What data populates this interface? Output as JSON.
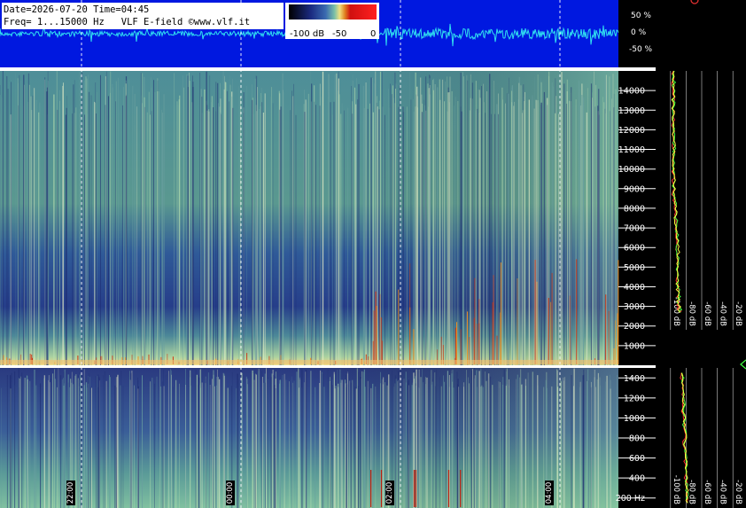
{
  "header": {
    "line1": "Date=2026-07-20 Time=04:45",
    "line2": "Freq= 1...15000 Hz   VLF E-field ©www.vlf.it"
  },
  "colorbar": {
    "labels": [
      "-100 dB",
      "-50",
      "0"
    ],
    "stops": [
      "#000000",
      "#1a2a80",
      "#3a6ab0",
      "#7ac0a8",
      "#f0e080",
      "#e08020",
      "#d01010",
      "#ff2020"
    ]
  },
  "waveform": {
    "ticks": [
      "50 %",
      "0 %",
      "-50 %"
    ],
    "background": "#0018e0",
    "trace_color": "#30e0f0"
  },
  "time_markers": [
    "22:00",
    "00:00",
    "02:00",
    "04:00"
  ],
  "chart_data": [
    {
      "type": "heatmap",
      "name": "upper-spectrogram",
      "y_ticks": [
        "14000",
        "13000",
        "12000",
        "11000",
        "10000",
        "9000",
        "8000",
        "7000",
        "6000",
        "5000",
        "4000",
        "3000",
        "2000",
        "1000"
      ],
      "ylim": [
        0,
        15000
      ],
      "x_ticks": [
        "22:00",
        "00:00",
        "02:00",
        "04:00"
      ],
      "grid": true
    },
    {
      "type": "heatmap",
      "name": "lower-spectrogram",
      "y_ticks": [
        "1400",
        "1200",
        "1000",
        "800",
        "600",
        "400",
        "200 Hz"
      ],
      "ylim": [
        100,
        1500
      ],
      "x_ticks": [
        "22:00",
        "00:00",
        "02:00",
        "04:00"
      ],
      "grid": true
    },
    {
      "type": "line",
      "name": "upper-spectrum",
      "x_ticks": [
        "-100 dB",
        "-80 dB",
        "-60 dB",
        "-40 dB",
        "-20 dB"
      ],
      "xlim": [
        -110,
        -10
      ],
      "series": [
        {
          "color": "#ff3030",
          "x": [
            -96,
            -97,
            -96,
            -97,
            -96,
            -97,
            -96,
            -97,
            -95,
            -93,
            -92,
            -91,
            -92,
            -90,
            -91,
            -88
          ],
          "y": [
            15000,
            14000,
            13000,
            12000,
            11000,
            10000,
            9000,
            8000,
            7000,
            6000,
            5000,
            4000,
            3000,
            2000,
            1500,
            1000
          ]
        },
        {
          "color": "#40ff40",
          "x": [
            -95,
            -96,
            -95,
            -96,
            -95,
            -96,
            -95,
            -96,
            -94,
            -92,
            -91,
            -90,
            -91,
            -89,
            -90,
            -87
          ],
          "y": [
            15000,
            14000,
            13000,
            12000,
            11000,
            10000,
            9000,
            8000,
            7000,
            6000,
            5000,
            4000,
            3000,
            2000,
            1500,
            1000
          ]
        },
        {
          "color": "#ffff40",
          "x": [
            -96,
            -96,
            -96,
            -96,
            -96,
            -96,
            -95,
            -96,
            -94,
            -93,
            -91,
            -90,
            -91,
            -90,
            -90,
            -88
          ],
          "y": [
            15000,
            14000,
            13000,
            12000,
            11000,
            10000,
            9000,
            8000,
            7000,
            6000,
            5000,
            4000,
            3000,
            2000,
            1500,
            1000
          ]
        }
      ]
    },
    {
      "type": "line",
      "name": "lower-spectrum",
      "x_ticks": [
        "-100 dB",
        "-80 dB",
        "-60 dB",
        "-40 dB",
        "-20 dB"
      ],
      "xlim": [
        -110,
        -10
      ],
      "series": [
        {
          "color": "#ff3030",
          "x": [
            -86,
            -85,
            -84,
            -83,
            -82,
            -81,
            -80,
            -79
          ],
          "y": [
            1450,
            1300,
            1100,
            900,
            700,
            500,
            300,
            150
          ]
        },
        {
          "color": "#40ff40",
          "x": [
            -85,
            -84,
            -83,
            -82,
            -81,
            -80,
            -79,
            -78
          ],
          "y": [
            1450,
            1300,
            1100,
            900,
            700,
            500,
            300,
            150
          ]
        },
        {
          "color": "#ffff40",
          "x": [
            -86,
            -84,
            -84,
            -82,
            -81,
            -81,
            -79,
            -78
          ],
          "y": [
            1450,
            1300,
            1100,
            900,
            700,
            500,
            300,
            150
          ]
        }
      ]
    }
  ]
}
